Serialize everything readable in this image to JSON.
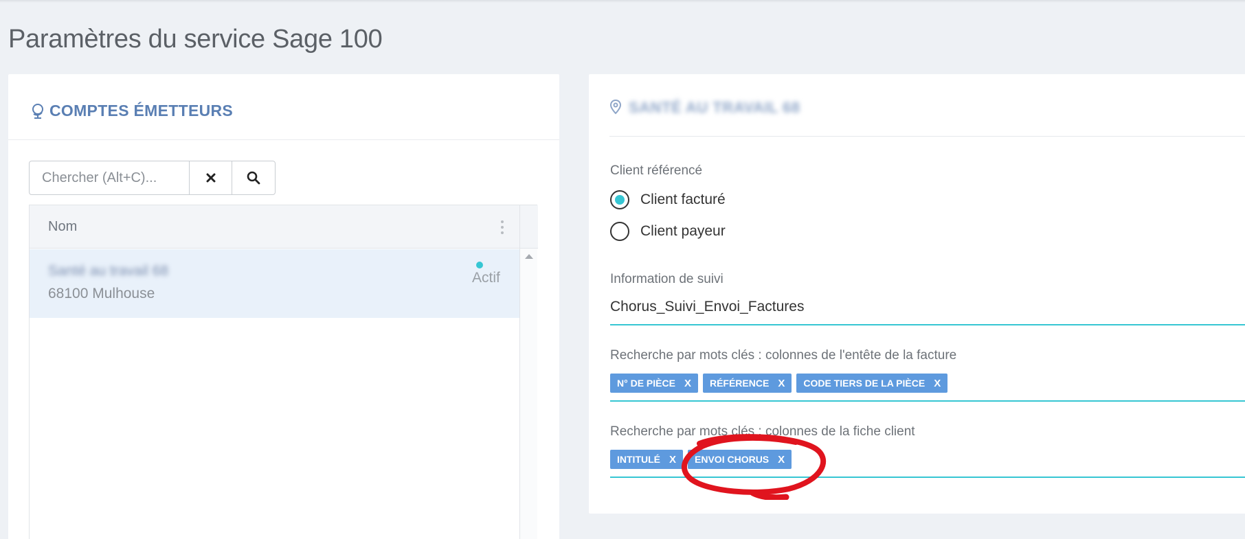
{
  "page": {
    "title": "Paramètres du service Sage 100"
  },
  "left_panel": {
    "title": "COMPTES ÉMETTEURS",
    "icon": "globe-icon",
    "search": {
      "placeholder": "Chercher (Alt+C)...",
      "value": "",
      "clear_icon": "close-icon",
      "search_icon": "search-icon"
    },
    "table": {
      "column": "Nom",
      "rows": [
        {
          "name": "Santé au travail 68",
          "city": "68100 Mulhouse",
          "status": "Actif"
        }
      ]
    }
  },
  "right_panel": {
    "title": "SANTÉ AU TRAVAIL 68",
    "icon": "location-pin-icon",
    "client_ref": {
      "label": "Client référencé",
      "options": [
        {
          "label": "Client facturé",
          "selected": true
        },
        {
          "label": "Client payeur",
          "selected": false
        }
      ]
    },
    "suivi": {
      "label": "Information de suivi",
      "value": "Chorus_Suivi_Envoi_Factures"
    },
    "keywords_header": {
      "label": "Recherche par mots clés : colonnes de l'entête de la facture",
      "tags": [
        "N° DE PIÈCE",
        "RÉFÉRENCE",
        "CODE TIERS DE LA PIÈCE"
      ]
    },
    "keywords_client": {
      "label": "Recherche par mots clés : colonnes de la fiche client",
      "tags": [
        "INTITULÉ",
        "ENVOI CHORUS"
      ]
    },
    "tag_remove": "X"
  },
  "colors": {
    "accent": "#36c6d3",
    "tag": "#5e9ade",
    "title_blue": "#5a7fb3",
    "annotation": "#e0141e"
  }
}
